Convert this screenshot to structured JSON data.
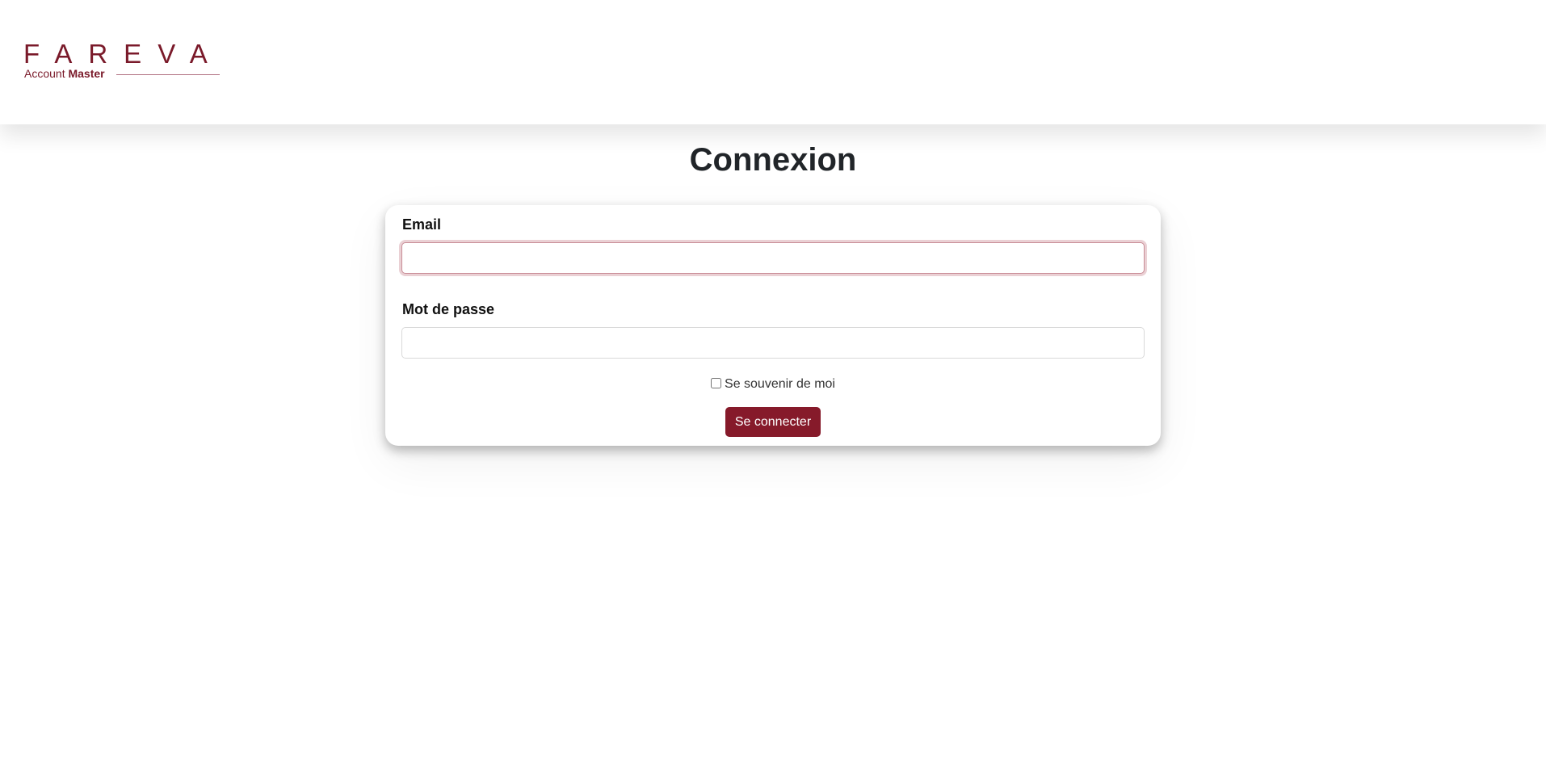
{
  "header": {
    "logo": {
      "brand": "FAREVA",
      "sub_light": "Account",
      "sub_bold": "Master"
    }
  },
  "page": {
    "title": "Connexion"
  },
  "form": {
    "email_label": "Email",
    "email_value": "",
    "password_label": "Mot de passe",
    "password_value": "",
    "remember_label": "Se souvenir de moi",
    "remember_checked": false,
    "submit_label": "Se connecter"
  },
  "colors": {
    "brand": "#861a2a",
    "logo": "#7a1a2a",
    "background": "#ffffff",
    "text": "#212529"
  }
}
